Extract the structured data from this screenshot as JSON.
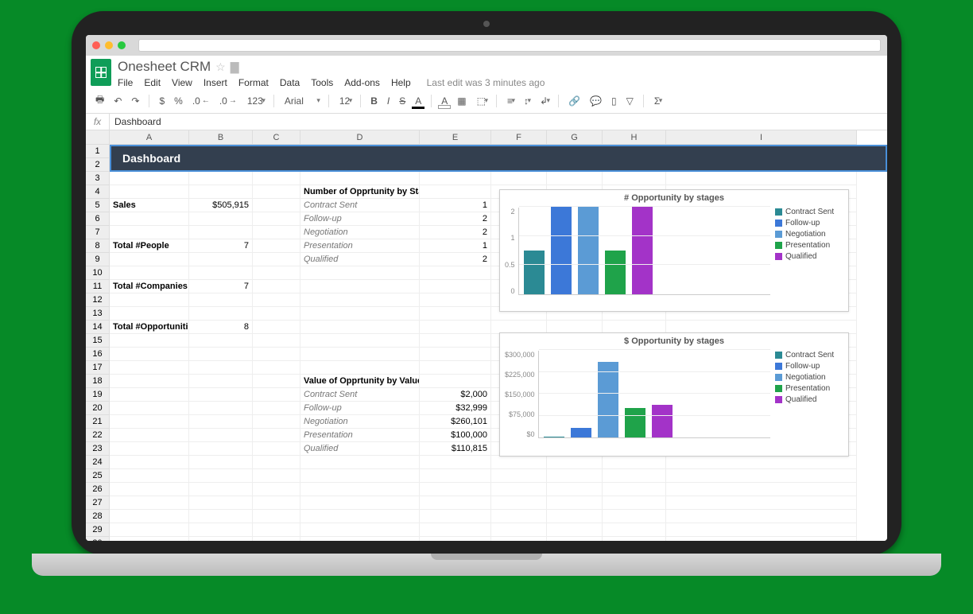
{
  "doc": {
    "title": "Onesheet CRM"
  },
  "menus": {
    "items": [
      "File",
      "Edit",
      "View",
      "Insert",
      "Format",
      "Data",
      "Tools",
      "Add-ons",
      "Help"
    ],
    "last_edit": "Last edit was 3 minutes ago"
  },
  "toolbar": {
    "currency": "$",
    "percent": "%",
    "dec_dec": ".0",
    "dec_inc": ".00",
    "num_fmt": "123",
    "font": "Arial",
    "size": "12",
    "bold": "B",
    "italic": "I",
    "strike": "S",
    "text_color": "A",
    "fill_color": "A"
  },
  "formula_bar": {
    "fx": "fx",
    "value": "Dashboard"
  },
  "columns": [
    "A",
    "B",
    "C",
    "D",
    "E",
    "F",
    "G",
    "H",
    "I"
  ],
  "row_count": 30,
  "dashboard_title": "Dashboard",
  "cells": {
    "A5": "Sales",
    "B5": "$505,915",
    "D4": "Number of Opprtunity by Stage",
    "D5": "Contract Sent",
    "E5": "1",
    "D6": "Follow-up",
    "E6": "2",
    "D7": "Negotiation",
    "E7": "2",
    "A8": "Total #People",
    "B8": "7",
    "D8": "Presentation",
    "E8": "1",
    "D9": "Qualified",
    "E9": "2",
    "A11": "Total #Companies",
    "B11": "7",
    "A14": "Total #Opportunities",
    "B14": "8",
    "D18": "Value of Opprtunity by Value",
    "D19": "Contract Sent",
    "E19": "$2,000",
    "D20": "Follow-up",
    "E20": "$32,999",
    "D21": "Negotiation",
    "E21": "$260,101",
    "D22": "Presentation",
    "E22": "$100,000",
    "D23": "Qualified",
    "E23": "$110,815"
  },
  "chart_data": [
    {
      "type": "bar",
      "title": "# Opportunity by stages",
      "categories": [
        "Contract Sent",
        "Follow-up",
        "Negotiation",
        "Presentation",
        "Qualified"
      ],
      "values": [
        1,
        2,
        2,
        1,
        2
      ],
      "ylim": [
        0,
        2
      ],
      "yticks": [
        "0",
        "0.5",
        "1",
        "2"
      ],
      "colors": [
        "#2b8a94",
        "#3c78d8",
        "#5b9bd5",
        "#1fa34a",
        "#a333c8"
      ]
    },
    {
      "type": "bar",
      "title": "$ Opportunity by stages",
      "categories": [
        "Contract Sent",
        "Follow-up",
        "Negotiation",
        "Presentation",
        "Qualified"
      ],
      "values": [
        2000,
        32999,
        260101,
        100000,
        110815
      ],
      "ylim": [
        0,
        300000
      ],
      "yticks": [
        "$0",
        "$75,000",
        "$150,000",
        "$225,000",
        "$300,000"
      ],
      "colors": [
        "#2b8a94",
        "#3c78d8",
        "#5b9bd5",
        "#1fa34a",
        "#a333c8"
      ]
    }
  ]
}
